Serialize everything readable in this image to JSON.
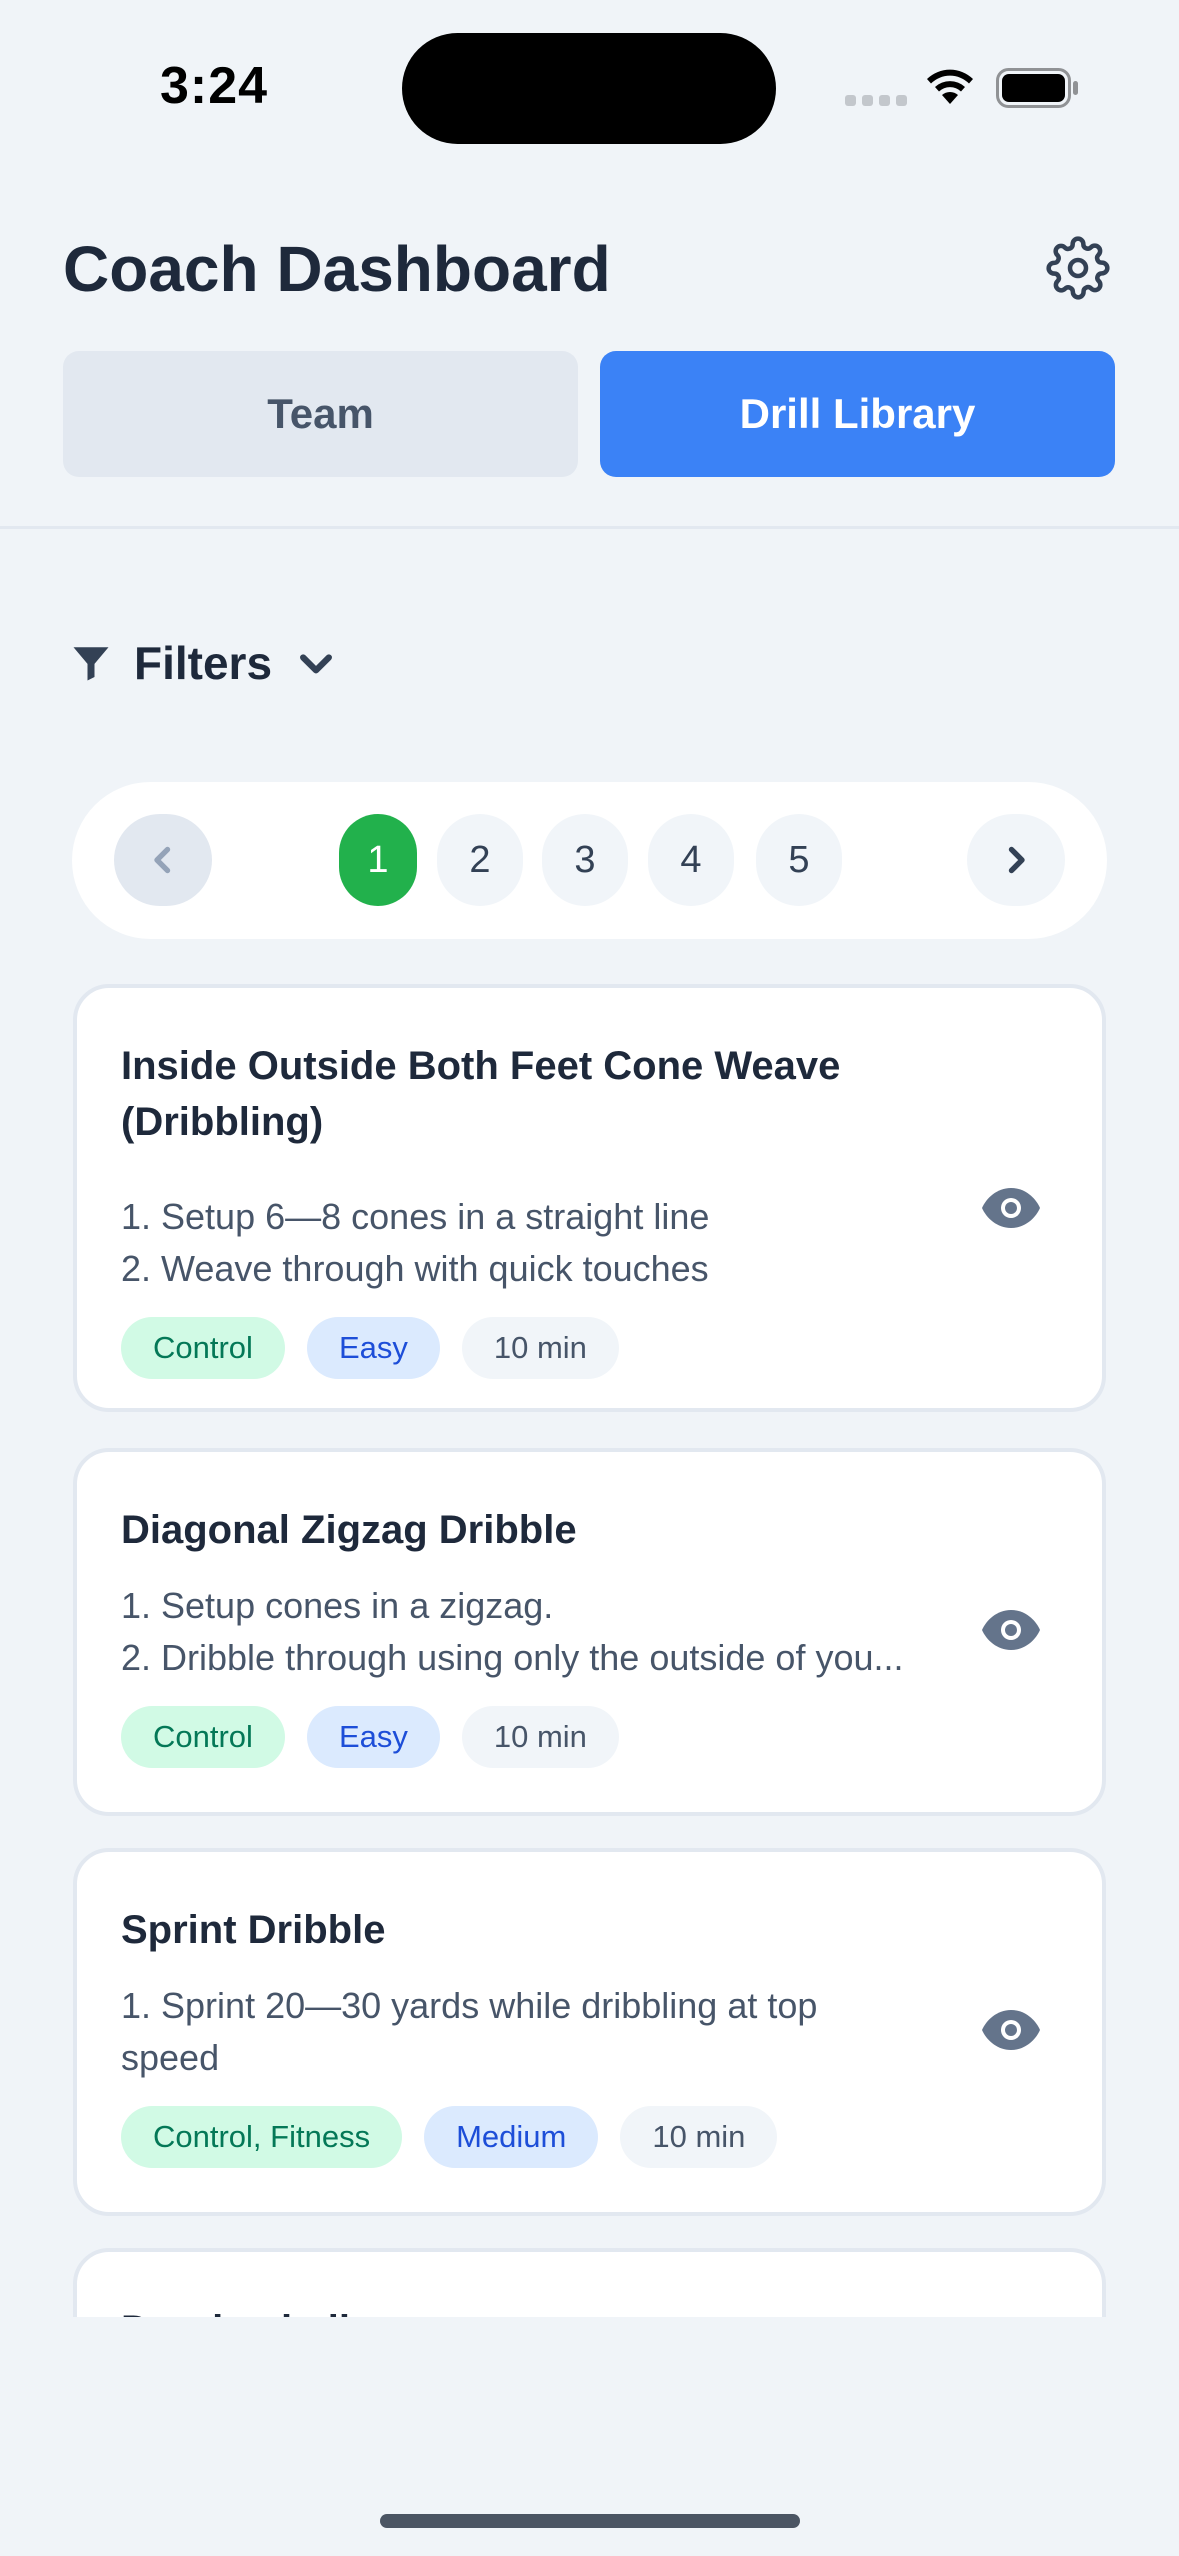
{
  "status_bar": {
    "time": "3:24"
  },
  "header": {
    "title": "Coach Dashboard",
    "settings_icon": "gear-icon"
  },
  "tabs": [
    {
      "label": "Team",
      "active": false
    },
    {
      "label": "Drill Library",
      "active": true
    }
  ],
  "filters": {
    "label": "Filters",
    "icon": "filter-icon",
    "toggle_icon": "chevron-down-icon"
  },
  "pagination": {
    "pages": [
      "1",
      "2",
      "3",
      "4",
      "5"
    ],
    "current": "1",
    "active_color": "#22b14c"
  },
  "drills": [
    {
      "title": "Inside Outside Both Feet Cone Weave (Dribbling)",
      "steps": [
        "1. Setup 6—8 cones in a straight line",
        "2. Weave through with quick touches"
      ],
      "tags": [
        "Control",
        "Easy",
        "10 min"
      ]
    },
    {
      "title": "Diagonal Zigzag Dribble",
      "steps": [
        "1. Setup cones in a zigzag.",
        "2. Dribble through using only the outside of you..."
      ],
      "tags": [
        "Control",
        "Easy",
        "10 min"
      ]
    },
    {
      "title": "Sprint Dribble",
      "steps": [
        "1. Sprint 20—30 yards while dribbling at top speed"
      ],
      "tags": [
        "Control, Fitness",
        "Medium",
        "10 min"
      ]
    },
    {
      "title": "Dragback dive"
    }
  ],
  "colors": {
    "accent": "#3b82f6",
    "background": "#f0f4f8"
  }
}
